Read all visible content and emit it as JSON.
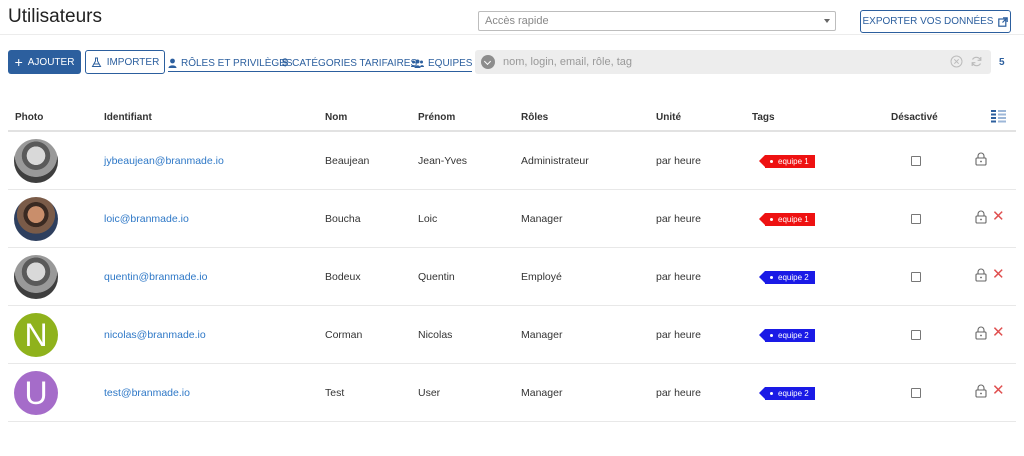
{
  "header": {
    "title": "Utilisateurs",
    "quick_access_placeholder": "Accès rapide",
    "export_label": "EXPORTER VOS DONNÉES"
  },
  "toolbar": {
    "add_label": "AJOUTER",
    "import_label": "IMPORTER",
    "roles_label": "RÔLES ET PRIVILÈGES",
    "categories_label": "CATÉGORIES TARIFAIRES",
    "teams_label": "EQUIPES",
    "search_placeholder": "nom, login, email, rôle, tag",
    "count": "5"
  },
  "table": {
    "columns": [
      "Photo",
      "Identifiant",
      "Nom",
      "Prénom",
      "Rôles",
      "Unité",
      "Tags",
      "Désactivé"
    ],
    "rows": [
      {
        "avatar": "photo",
        "avatar_letter": "",
        "avatar_color": "#777777",
        "email": "jybeaujean@branmade.io",
        "nom": "Beaujean",
        "prenom": "Jean-Yves",
        "role": "Administrateur",
        "unite": "par heure",
        "tag": "equipe 1",
        "tag_color": "#ee1111",
        "deletable": false
      },
      {
        "avatar": "photo-color",
        "avatar_letter": "",
        "avatar_color": "#8a5a40",
        "email": "loic@branmade.io",
        "nom": "Boucha",
        "prenom": "Loic",
        "role": "Manager",
        "unite": "par heure",
        "tag": "equipe 1",
        "tag_color": "#ee1111",
        "deletable": true
      },
      {
        "avatar": "photo",
        "avatar_letter": "",
        "avatar_color": "#777777",
        "email": "quentin@branmade.io",
        "nom": "Bodeux",
        "prenom": "Quentin",
        "role": "Employé",
        "unite": "par heure",
        "tag": "equipe 2",
        "tag_color": "#1a1ae6",
        "deletable": true
      },
      {
        "avatar": "letter",
        "avatar_letter": "N",
        "avatar_color": "#8fb21c",
        "email": "nicolas@branmade.io",
        "nom": "Corman",
        "prenom": "Nicolas",
        "role": "Manager",
        "unite": "par heure",
        "tag": "equipe 2",
        "tag_color": "#1a1ae6",
        "deletable": true
      },
      {
        "avatar": "letter",
        "avatar_letter": "U",
        "avatar_color": "#a56cc9",
        "email": "test@branmade.io",
        "nom": "Test",
        "prenom": "User",
        "role": "Manager",
        "unite": "par heure",
        "tag": "equipe 2",
        "tag_color": "#1a1ae6",
        "deletable": true
      }
    ]
  },
  "colors": {
    "primary": "#2c5f9e",
    "link": "#2e78c7",
    "delete": "#e05050"
  },
  "icons": [
    "external-link-icon",
    "plus-icon",
    "flask-icon",
    "user-icon",
    "dollar-icon",
    "users-icon",
    "chevron-down-icon",
    "clear-circle-icon",
    "refresh-icon",
    "columns-icon",
    "lock-icon",
    "close-icon"
  ]
}
